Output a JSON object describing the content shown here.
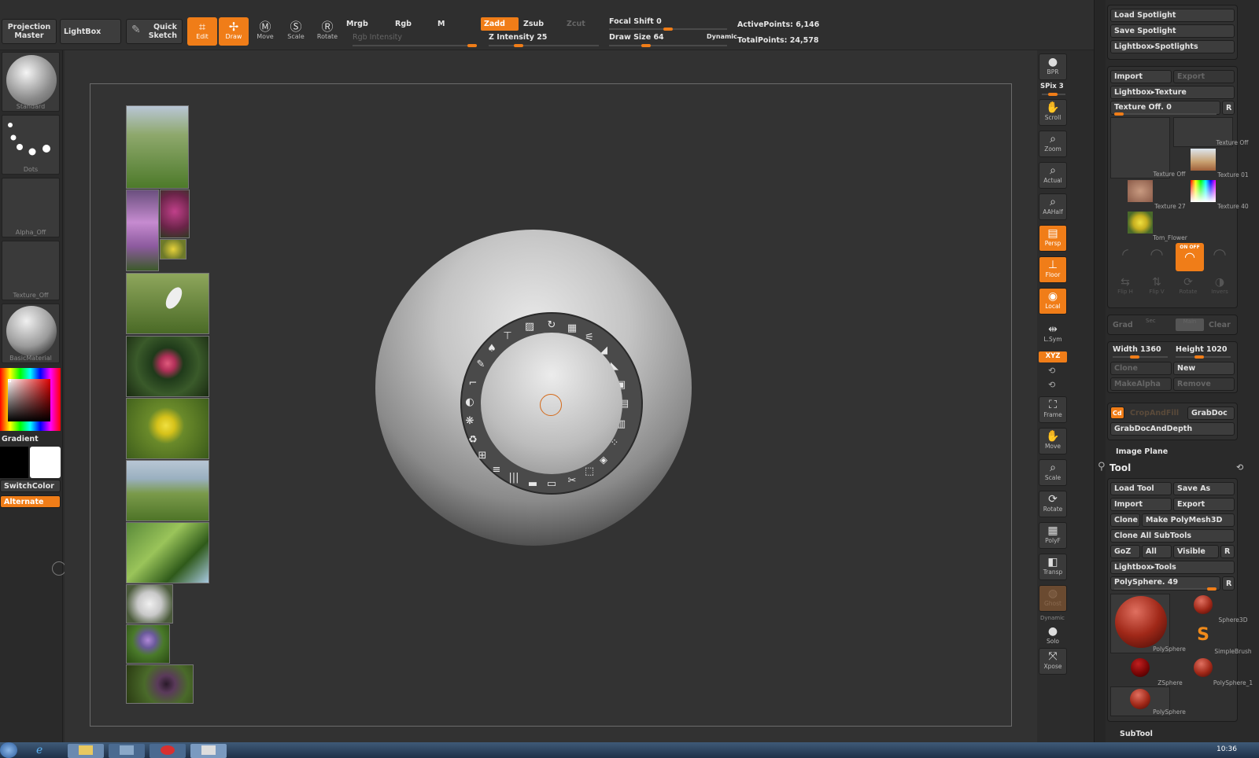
{
  "topbar": {
    "projection_master": "Projection Master",
    "lightbox": "LightBox",
    "quick_sketch": "Quick Sketch",
    "edit": "Edit",
    "draw": "Draw",
    "move": "Move",
    "scale": "Scale",
    "rotate": "Rotate",
    "mrgb": "Mrgb",
    "rgb": "Rgb",
    "m": "M",
    "zadd": "Zadd",
    "zsub": "Zsub",
    "zcut": "Zcut",
    "rgb_intensity": "Rgb Intensity",
    "z_intensity": "Z Intensity 25",
    "focal_shift": "Focal Shift 0",
    "draw_size": "Draw Size 64",
    "dynamic": "Dynamic",
    "active_points": "ActivePoints: 6,146",
    "total_points": "TotalPoints: 24,578",
    "z_intensity_level": 0.25,
    "rgb_intensity_level": 1.0,
    "focal_shift_level": 0.5,
    "draw_size_level": 0.3
  },
  "left_tray": {
    "brush": "Standard",
    "stroke": "Dots",
    "alpha": "Alpha_Off",
    "texture": "Texture_Off",
    "material": "BasicMaterial",
    "gradient": "Gradient",
    "switch_color": "SwitchColor",
    "alternate": "Alternate"
  },
  "right_tray": {
    "bpr": "BPR",
    "spix": "SPix 3",
    "items": [
      "Scroll",
      "Zoom",
      "Actual",
      "AAHalf",
      "Persp",
      "Floor",
      "Local",
      "L.Sym",
      "Frame",
      "Move",
      "Scale",
      "Rotate",
      "PolyF",
      "Transp",
      "Ghost",
      "Solo",
      "Xpose"
    ],
    "xyz": "XYZ",
    "dynamic": "Dynamic"
  },
  "panel": {
    "load_spotlight": "Load Spotlight",
    "save_spotlight": "Save Spotlight",
    "lightbox_spotlights": "Lightbox▸Spotlights",
    "import": "Import",
    "export": "Export",
    "lightbox_texture": "Lightbox▸Texture",
    "texture_off": "Texture Off. 0",
    "r": "R",
    "textures": [
      "Texture Off",
      "Texture Off",
      "Texture 01",
      "Texture 27",
      "Texture 40",
      "Tom_Flower"
    ],
    "on_off": "ON OFF",
    "icons": [
      "Flip H",
      "Flip V",
      "Rotate",
      "Invers"
    ],
    "grad": "Grad",
    "sec": "Sec",
    "main": "Main",
    "clear": "Clear",
    "width": "Width 1360",
    "height": "Height 1020",
    "clone": "Clone",
    "new": "New",
    "make_alpha": "MakeAlpha",
    "remove": "Remove",
    "cd": "Cd",
    "crop_and_fill": "CropAndFill",
    "grab_doc": "GrabDoc",
    "grab_doc_depth": "GrabDocAndDepth",
    "image_plane": "Image Plane",
    "tool_title": "Tool",
    "load_tool": "Load Tool",
    "save_as": "Save As",
    "tool_import": "Import",
    "tool_export": "Export",
    "tool_clone": "Clone",
    "make_polymesh": "Make PolyMesh3D",
    "clone_all": "Clone All SubTools",
    "goz": "GoZ",
    "all": "All",
    "visible": "Visible",
    "lightbox_tools": "Lightbox▸Tools",
    "polysphere": "PolySphere. 49",
    "tools": [
      "PolySphere",
      "Sphere3D",
      "SimpleBrush",
      "ZSphere",
      "PolySphere_1",
      "PolySphere"
    ],
    "subtool": "SubTool"
  },
  "taskbar": {
    "clock": "10:36"
  },
  "colors": {
    "accent": "#f07d18"
  }
}
